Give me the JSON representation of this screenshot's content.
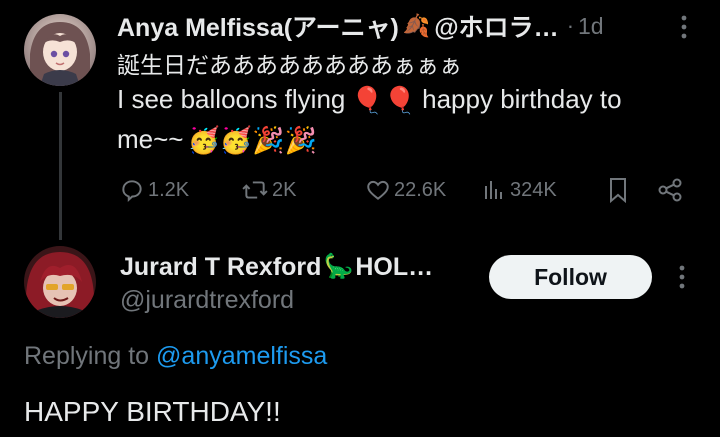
{
  "tweet": {
    "author_name": "Anya Melfissa(アーニャ)",
    "author_emoji": "🍂",
    "handle": "@ホロラ…",
    "time_sep": "·",
    "time": "1d",
    "line1": "誕生日だああああああああぁぁぁ",
    "line2_a": "I see balloons flying",
    "balloons": "🎈🎈",
    "line2_b": "happy birthday to",
    "line3_text": "me~~",
    "line3_emojis": "🥳🥳🎉🎉",
    "stats": {
      "replies": "1.2K",
      "retweets": "2K",
      "likes": "22.6K",
      "views": "324K"
    }
  },
  "reply": {
    "author_name": "Jurard T Rexford",
    "author_emoji": "🦕",
    "author_suffix": "HOL…",
    "handle": "@jurardtrexford",
    "follow_label": "Follow",
    "replying_prefix": "Replying to",
    "replying_handle": "@anyamelfissa",
    "text": "HAPPY BIRTHDAY!!"
  },
  "colors": {
    "background": "#000000",
    "text": "#e7e9ea",
    "muted": "#71767b",
    "link": "#1d9bf0",
    "follow_bg": "#eff3f4"
  }
}
